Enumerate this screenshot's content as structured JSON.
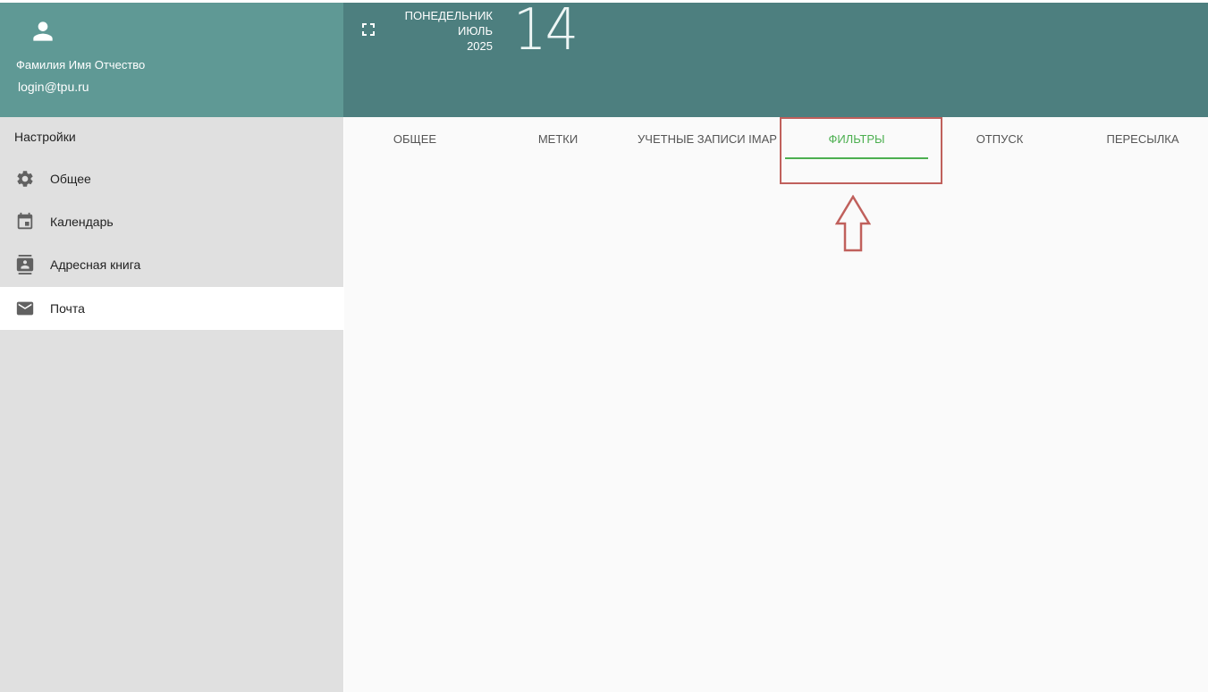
{
  "user": {
    "name": "Фамилия Имя Отчество",
    "login": "login@tpu.ru",
    "avatar_icon": "person-icon"
  },
  "date": {
    "weekday": "ПОНЕДЕЛЬНИК",
    "month": "ИЮЛЬ",
    "year": "2025",
    "day": "14"
  },
  "sidebar": {
    "title": "Настройки",
    "items": [
      {
        "label": "Общее",
        "icon": "gear-icon",
        "active": false
      },
      {
        "label": "Календарь",
        "icon": "calendar-icon",
        "active": false
      },
      {
        "label": "Адресная книга",
        "icon": "contacts-icon",
        "active": false
      },
      {
        "label": "Почта",
        "icon": "mail-icon",
        "active": true
      }
    ]
  },
  "tabs": [
    {
      "label": "ОБЩЕЕ",
      "active": false
    },
    {
      "label": "МЕТКИ",
      "active": false
    },
    {
      "label": "УЧЕТНЫЕ ЗАПИСИ IMAP",
      "active": false
    },
    {
      "label": "ФИЛЬТРЫ",
      "active": true
    },
    {
      "label": "ОТПУСК",
      "active": false
    },
    {
      "label": "ПЕРЕСЫЛКА",
      "active": false
    }
  ],
  "colors": {
    "user_header": "#5f9995",
    "top_bar": "#4d7f7f",
    "sidebar": "#e0e0e0",
    "active_tab": "#4caf50",
    "highlight": "#c0605c"
  }
}
